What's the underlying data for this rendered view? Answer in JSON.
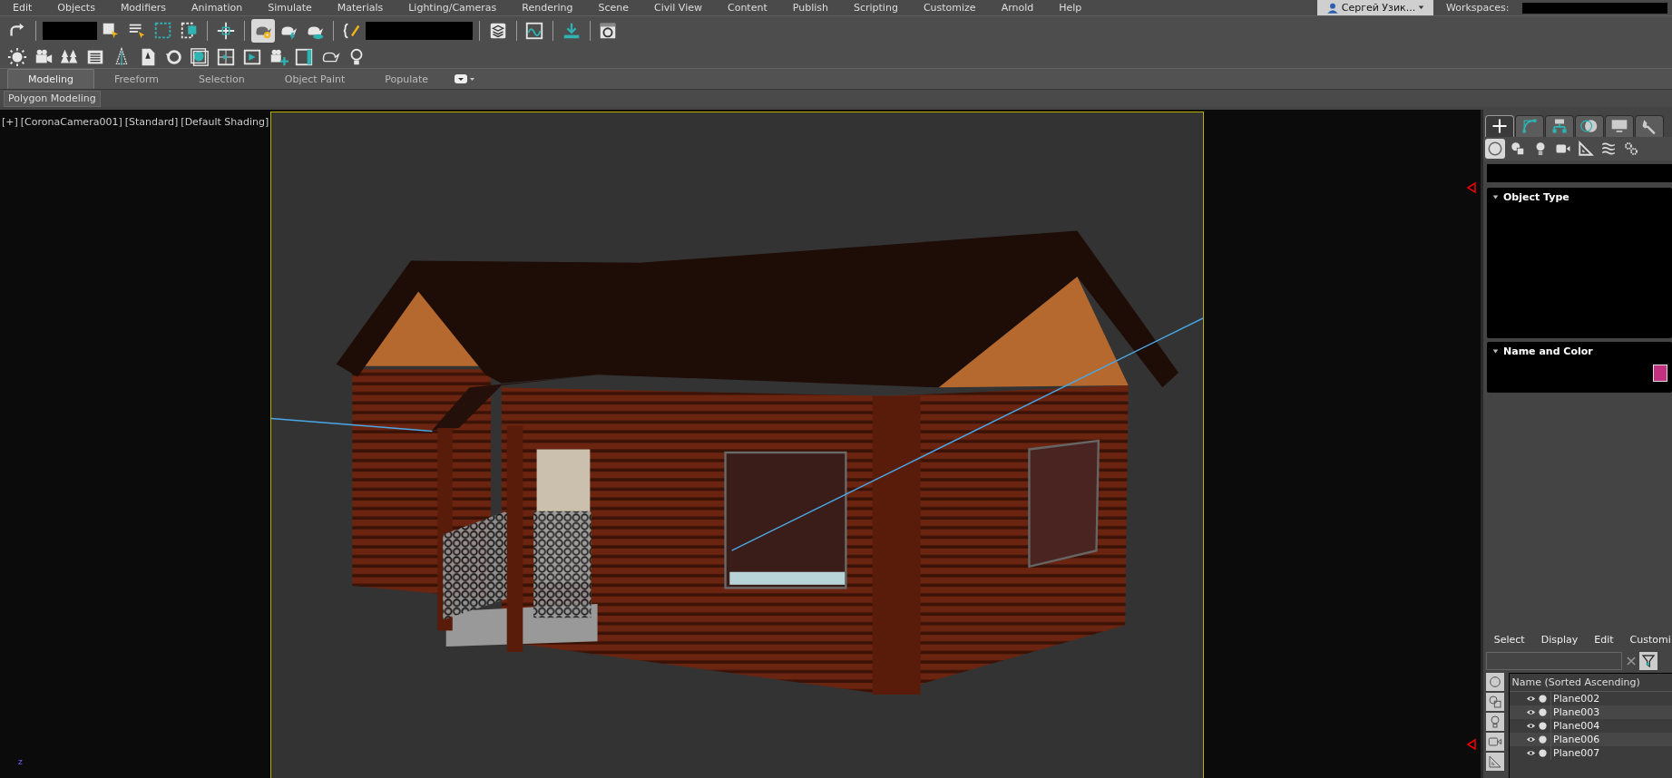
{
  "menu_bar": {
    "items": [
      "Edit",
      "Objects",
      "Modifiers",
      "Animation",
      "Simulate",
      "Materials",
      "Lighting/Cameras",
      "Rendering",
      "Scene",
      "Civil View",
      "Content",
      "Publish",
      "Scripting",
      "Customize",
      "Arnold",
      "Help"
    ],
    "user": "Сергей Узик...",
    "workspaces_label": "Workspaces:"
  },
  "ribbon": {
    "tabs": [
      {
        "label": "Modeling",
        "selected": true
      },
      {
        "label": "Freeform",
        "selected": false
      },
      {
        "label": "Selection",
        "selected": false
      },
      {
        "label": "Object Paint",
        "selected": false
      },
      {
        "label": "Populate",
        "selected": false
      }
    ],
    "panel_label": "Polygon Modeling"
  },
  "viewport": {
    "labels": [
      "[+]",
      "[CoronaCamera001]",
      "[Standard]",
      "[Default Shading]"
    ],
    "axis_label": "z"
  },
  "command_panel": {
    "tabs": [
      {
        "selected": true
      },
      {
        "selected": false
      },
      {
        "selected": false
      },
      {
        "selected": false
      },
      {
        "selected": false
      },
      {
        "selected": false
      }
    ],
    "categories": [
      {
        "selected": true
      },
      {
        "selected": false
      },
      {
        "selected": false
      },
      {
        "selected": false
      },
      {
        "selected": false
      },
      {
        "selected": false
      },
      {
        "selected": false
      }
    ],
    "rollouts": [
      {
        "title": "Object Type",
        "expanded": true
      },
      {
        "title": "Name and Color",
        "expanded": true,
        "color": "#c2307f"
      }
    ]
  },
  "scene_explorer": {
    "menu": [
      "Select",
      "Display",
      "Edit",
      "Customi"
    ],
    "column": "Name (Sorted Ascending)",
    "rows": [
      {
        "name": "Plane002"
      },
      {
        "name": "Plane003"
      },
      {
        "name": "Plane004"
      },
      {
        "name": "Plane006"
      },
      {
        "name": "Plane007"
      }
    ]
  }
}
